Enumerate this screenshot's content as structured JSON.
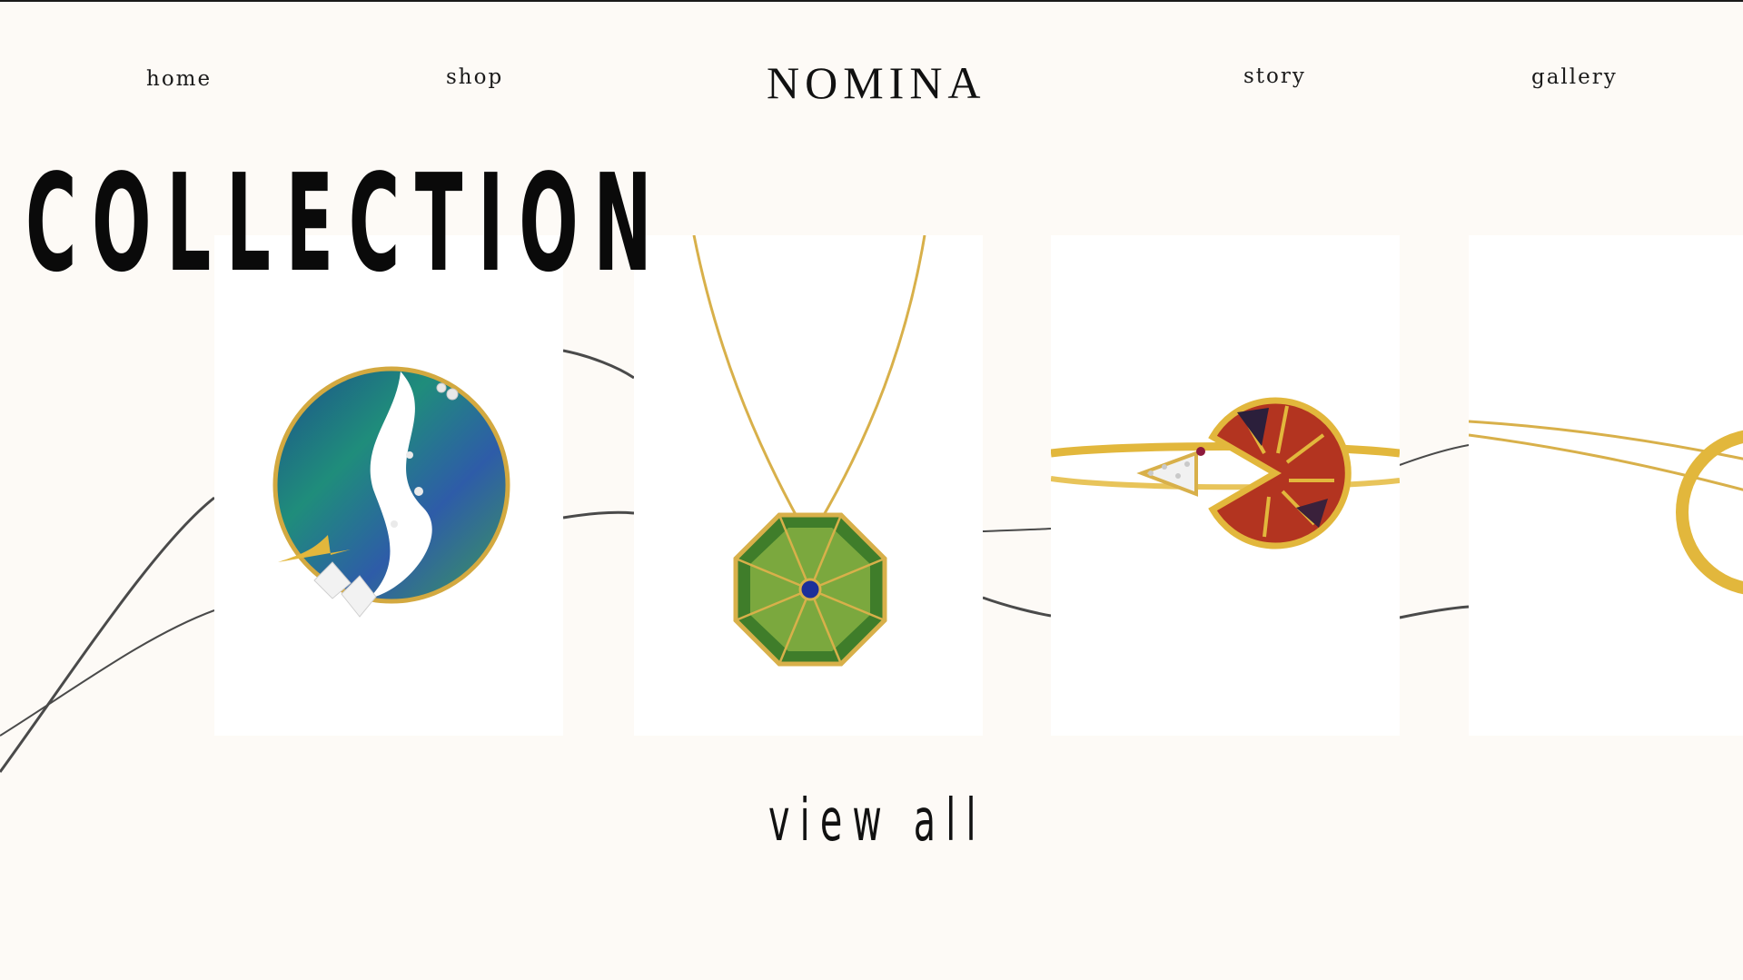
{
  "nav": {
    "home": "home",
    "shop": "shop",
    "story": "story",
    "gallery": "gallery"
  },
  "brand": {
    "logo": "NOMINA"
  },
  "collection": {
    "heading": "COLLECTION",
    "cta": "view all",
    "products": [
      {
        "icon": "enamel-moon-brooch-image"
      },
      {
        "icon": "octagon-enamel-pendant-necklace-image"
      },
      {
        "icon": "enamel-bangle-bracelet-image"
      },
      {
        "icon": "gold-hoop-necklace-image"
      }
    ]
  },
  "colors": {
    "background": "#fdfaf6",
    "card": "#ffffff",
    "text": "#111111",
    "gold": "#e2b73c"
  }
}
